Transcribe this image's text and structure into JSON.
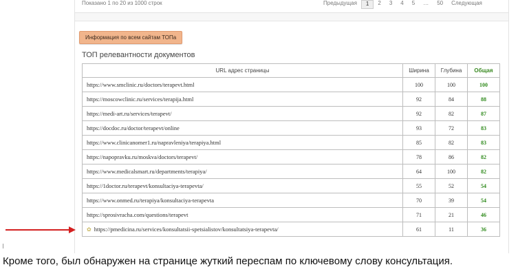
{
  "pager": {
    "info": "Показано 1 по 20 из 1000 строк",
    "prev": "Предыдущая",
    "pages": [
      "1",
      "2",
      "3",
      "4",
      "5",
      "…",
      "50"
    ],
    "next": "Следующая"
  },
  "info_button": "Информация по всем сайтам ТОПа",
  "section_title": "ТОП релевантности документов",
  "table": {
    "headers": {
      "url": "URL адрес страницы",
      "width": "Ширина",
      "depth": "Глубина",
      "total": "Общая"
    },
    "rows": [
      {
        "url": "https://www.smclinic.ru/doctors/terapevt.html",
        "width": "100",
        "depth": "100",
        "total": "100"
      },
      {
        "url": "https://moscowclinic.ru/services/terapija.html",
        "width": "92",
        "depth": "84",
        "total": "88"
      },
      {
        "url": "https://medi-art.ru/services/terapevt/",
        "width": "92",
        "depth": "82",
        "total": "87"
      },
      {
        "url": "https://docdoc.ru/doctor/terapevt/online",
        "width": "93",
        "depth": "72",
        "total": "83"
      },
      {
        "url": "https://www.clinicanomer1.ru/napravleniya/terapiya.html",
        "width": "85",
        "depth": "82",
        "total": "83"
      },
      {
        "url": "https://napopravku.ru/moskva/doctors/terapevt/",
        "width": "78",
        "depth": "86",
        "total": "82"
      },
      {
        "url": "https://www.medicalsmart.ru/departments/terapiya/",
        "width": "64",
        "depth": "100",
        "total": "82"
      },
      {
        "url": "https://1doctor.ru/terapevt/konsultaciya-terapevta/",
        "width": "55",
        "depth": "52",
        "total": "54"
      },
      {
        "url": "https://www.onmed.ru/terapiya/konsultaciya-terapevta",
        "width": "70",
        "depth": "39",
        "total": "54"
      },
      {
        "url": "https://sprosivracha.com/questions/terapevt",
        "width": "71",
        "depth": "21",
        "total": "46"
      },
      {
        "url": "https://pmedicina.ru/services/konsultatsii-spetsialistov/konsultatsiya-terapevta/",
        "width": "61",
        "depth": "11",
        "total": "36",
        "highlight": true
      }
    ]
  },
  "caption": "Кроме того, был обнаружен на странице жуткий переспам по ключевому слову консультация.",
  "colors": {
    "accent_green": "#2f8a1c",
    "button_bg": "#f1b58c",
    "arrow": "#d42020"
  }
}
